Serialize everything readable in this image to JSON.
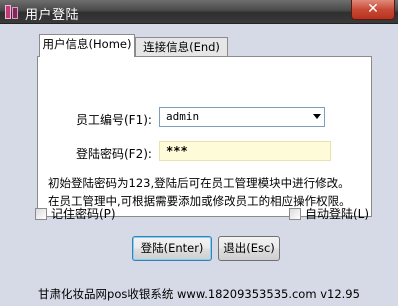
{
  "window": {
    "title": "用户登陆",
    "close_label": "✕"
  },
  "tabs": [
    {
      "label": "用户信息(Home)",
      "active": true
    },
    {
      "label": "连接信息(End)",
      "active": false
    }
  ],
  "form": {
    "employee_label": "员工编号(F1):",
    "employee_value": "admin",
    "password_label": "登陆密码(F2):",
    "password_value": "***"
  },
  "info": {
    "line1": "初始登陆密码为123,登陆后可在员工管理模块中进行修改。",
    "line2": "在员工管理中,可根据需要添加或修改员工的相应操作权限。"
  },
  "options": {
    "remember_label": "记住密码(P)",
    "remember_checked": false,
    "auto_label": "自动登陆(L)",
    "auto_checked": false
  },
  "buttons": {
    "login_label": "登陆(Enter)",
    "exit_label": "退出(Esc)"
  },
  "footer": {
    "text": "甘肃化妆品网pos收银系统 www.18209353535.com v12.95"
  },
  "colors": {
    "window_bg": "#d6d9e6",
    "password_bg": "#fefbd8",
    "close_button": "#c74a36"
  },
  "icons": {
    "app": "app-icon",
    "close": "close-icon",
    "dropdown": "chevron-down-icon"
  }
}
